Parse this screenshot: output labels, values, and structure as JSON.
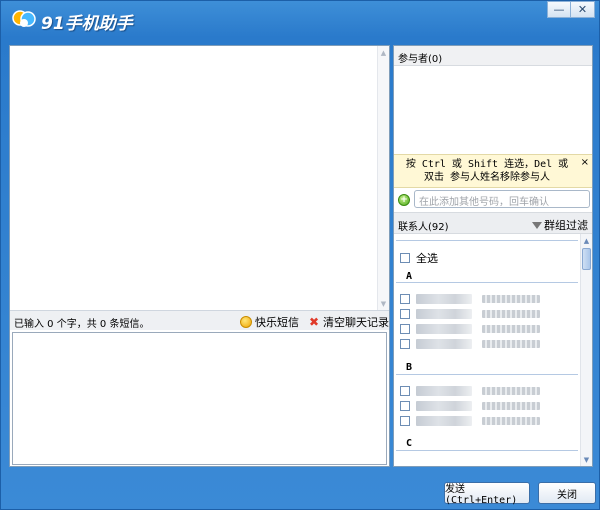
{
  "window": {
    "title": "91手机助手",
    "min_label": "—",
    "close_label": "✕"
  },
  "chat": {
    "info_text": "已输入 0 个字，共 0 条短信。",
    "happy_sms": "快乐短信",
    "clear_history": "清空聊天记录"
  },
  "participants": {
    "title": "参与者(0)",
    "hint": "按 Ctrl 或 Shift 连选，Del 或 双击 参与人姓名移除参与人",
    "hint_close": "×",
    "add_placeholder": "在此添加其他号码，回车确认"
  },
  "contacts": {
    "title": "联系人(92)",
    "group_filter": "群组过滤",
    "select_all": "全选",
    "groups": [
      {
        "letter": "A",
        "count": 4
      },
      {
        "letter": "B",
        "count": 3
      },
      {
        "letter": "C",
        "count": 0
      }
    ]
  },
  "buttons": {
    "send": "发送(Ctrl+Enter)",
    "close": "关闭"
  },
  "colors": {
    "titlebar": "#2a7acb",
    "hint_bg": "#fff8d6"
  }
}
